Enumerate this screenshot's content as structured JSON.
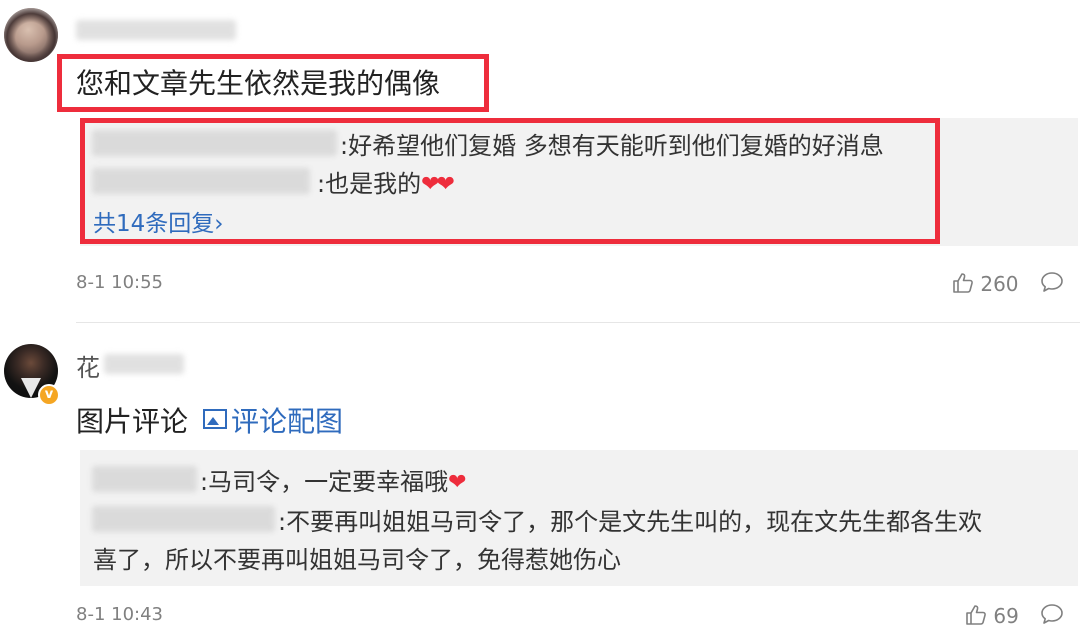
{
  "comments": [
    {
      "text": "您和文章先生依然是我的偶像",
      "replies": [
        {
          "text": ":好希望他们复婚 多想有天能听到他们复婚的好消息"
        },
        {
          "text": ":也是我的",
          "hearts": "❤❤"
        }
      ],
      "more_replies": "共14条回复",
      "more_arrow": "›",
      "time": "8-1 10:55",
      "likes": "260"
    },
    {
      "username_visible": "花",
      "text": "图片评论",
      "image_link": "评论配图",
      "replies": [
        {
          "text": ":马司令，一定要幸福哦",
          "hearts": "❤"
        },
        {
          "text_line1": ":不要再叫姐姐马司令了，那个是文先生叫的，现在文先生都各生欢",
          "text_line2": "喜了，所以不要再叫姐姐马司令了，免得惹她伤心"
        }
      ],
      "time": "8-1 10:43",
      "likes": "69"
    }
  ],
  "icons": {
    "like": "thumbs-up-icon",
    "reply": "speech-bubble-icon",
    "image": "image-icon",
    "verified": "verified-badge-icon"
  },
  "colors": {
    "highlight": "#ee2d3c",
    "link": "#2f6bbd",
    "reply_bg": "#f2f2f2",
    "meta_text": "#808080"
  }
}
